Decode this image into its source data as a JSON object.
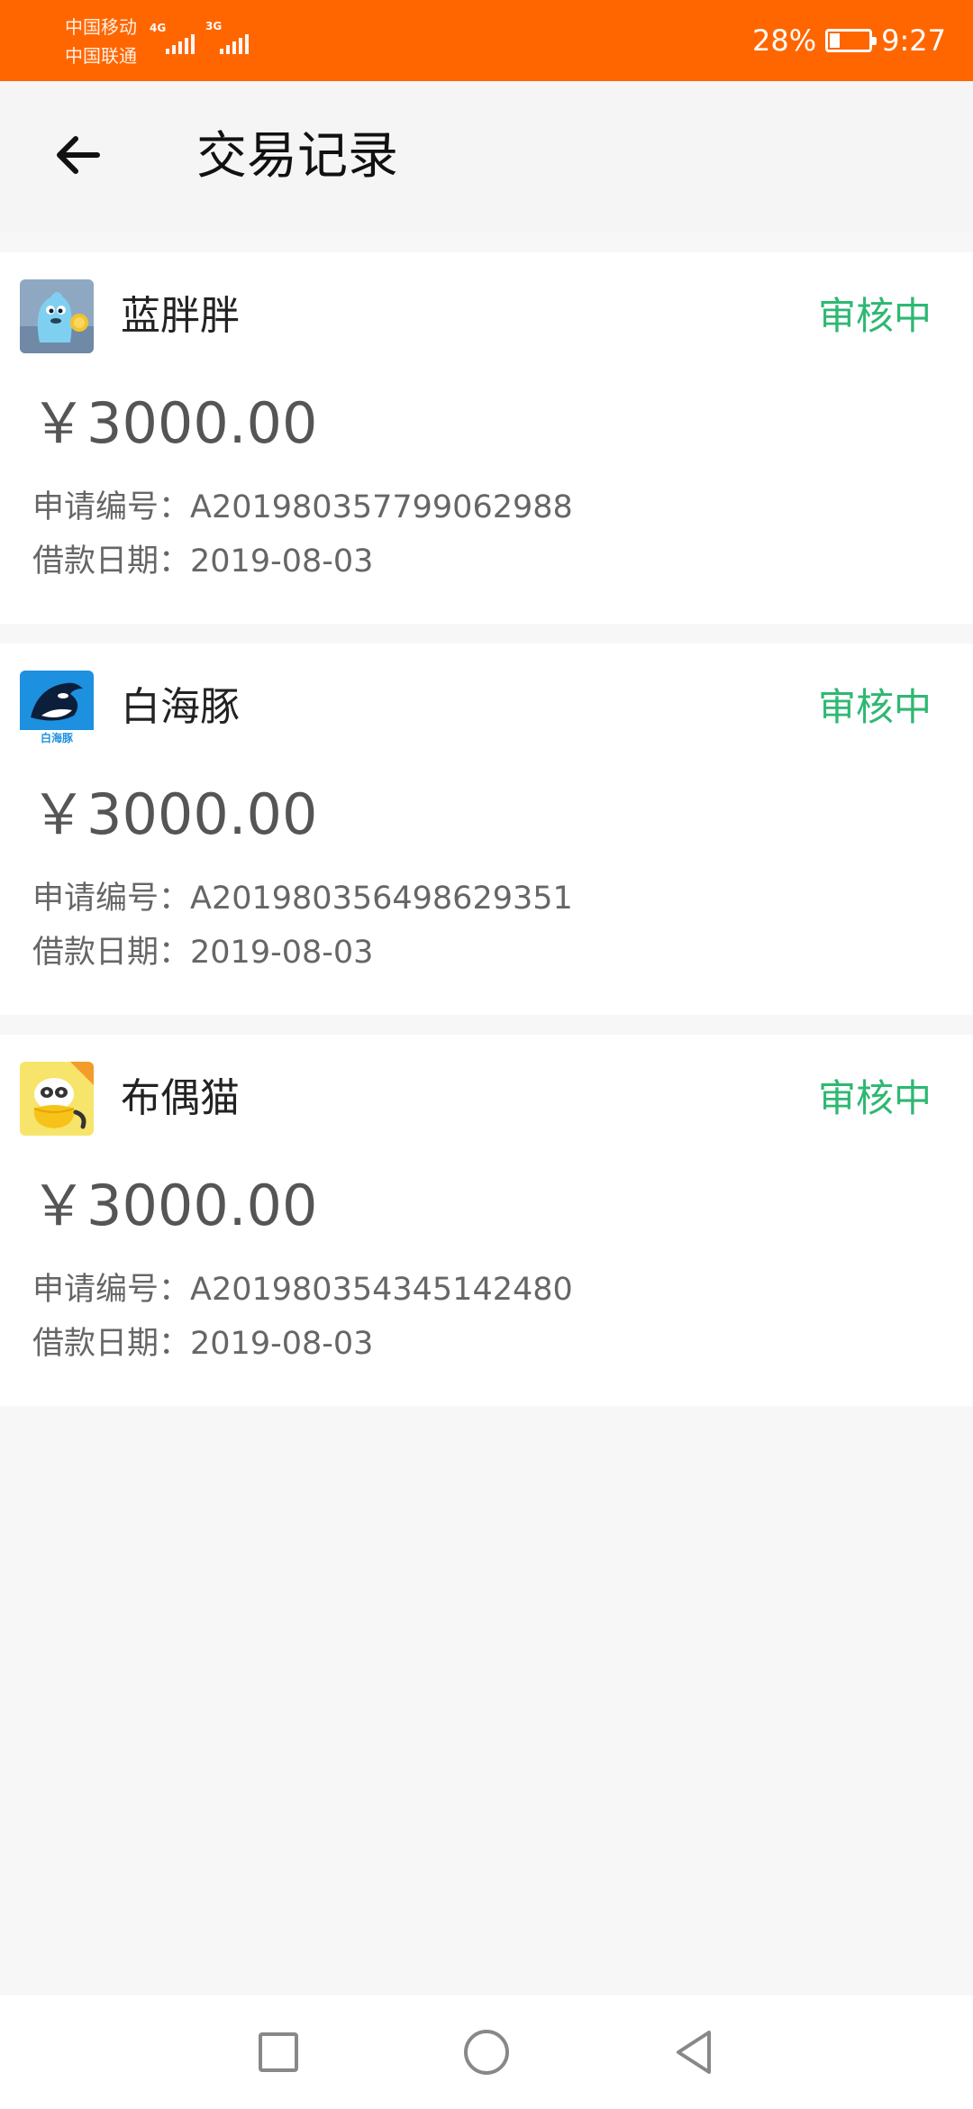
{
  "status_bar": {
    "carrier_1": "中国移动",
    "carrier_2": "中国联通",
    "network_1": "4G",
    "network_2": "3G",
    "battery": "28%",
    "battery_level_percent": 28,
    "time": "9:27"
  },
  "header": {
    "title": "交易记录",
    "back_icon": "arrow-left-icon"
  },
  "records": [
    {
      "app_name": "蓝胖胖",
      "status": "审核中",
      "amount": "￥3000.00",
      "application_label": "申请编号：",
      "application_no": "A201980357799062988",
      "date_label": "借款日期：",
      "date": "2019-08-03",
      "icon": "blue-mascot-icon"
    },
    {
      "app_name": "白海豚",
      "status": "审核中",
      "amount": "￥3000.00",
      "application_label": "申请编号：",
      "application_no": "A201980356498629351",
      "date_label": "借款日期：",
      "date": "2019-08-03",
      "icon": "dolphin-icon",
      "icon_text": "白海豚"
    },
    {
      "app_name": "布偶猫",
      "status": "审核中",
      "amount": "￥3000.00",
      "application_label": "申请编号：",
      "application_no": "A201980354345142480",
      "date_label": "借款日期：",
      "date": "2019-08-03",
      "icon": "raccoon-cat-icon"
    }
  ],
  "nav": {
    "recent_icon": "square-icon",
    "home_icon": "circle-icon",
    "back_icon": "triangle-back-icon"
  },
  "colors": {
    "status_bar": "#ff6600",
    "status_text": "#2eb872",
    "background": "#f7f7f7"
  }
}
